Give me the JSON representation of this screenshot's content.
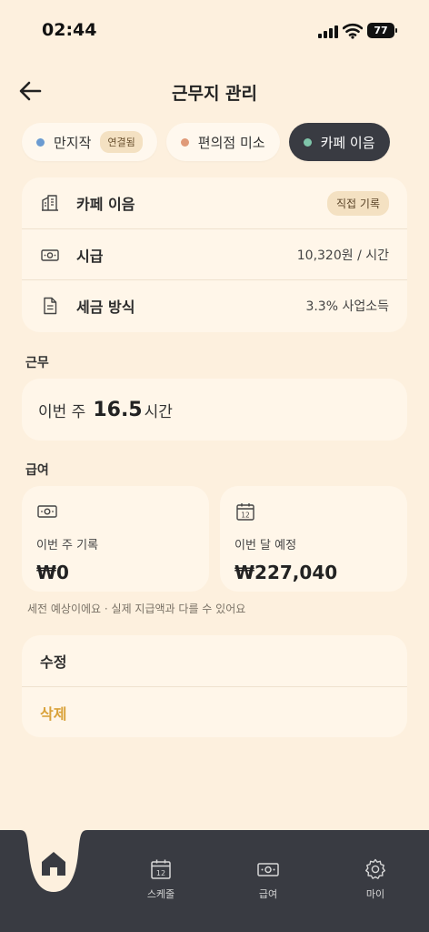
{
  "status_bar": {
    "time": "02:44",
    "battery": "77"
  },
  "header": {
    "title": "근무지 관리"
  },
  "workplaces": [
    {
      "name": "만지작",
      "tag": "연결됨",
      "color": "#6B9BD1",
      "active": false
    },
    {
      "name": "편의점 미소",
      "tag": "",
      "color": "#E09A78",
      "active": false
    },
    {
      "name": "카페 이음",
      "tag": "",
      "color": "#7FC5AA",
      "active": true
    }
  ],
  "details": {
    "name_label": "카페 이음",
    "name_badge": "직접 기록",
    "wage_label": "시급",
    "wage_value": "10,320원 / 시간",
    "tax_label": "세금 방식",
    "tax_value": "3.3% 사업소득"
  },
  "work": {
    "section": "근무",
    "prefix": "이번 주",
    "hours": "16.5",
    "unit": "시간"
  },
  "pay": {
    "section": "급여",
    "week_label": "이번 주 기록",
    "week_value": "₩0",
    "month_label": "이번 달 예정",
    "month_value": "₩227,040",
    "note": "세전 예상이에요 · 실제 지급액과 다를 수 있어요"
  },
  "actions": {
    "edit": "수정",
    "delete": "삭제"
  },
  "tabbar": {
    "schedule": "스케줄",
    "pay": "급여",
    "my": "마이",
    "calendar_day": "12"
  },
  "colors": {
    "background": "#FDF0DE",
    "card": "#FFF6E9",
    "tabbar": "#393B42",
    "accent": "#D9A23A"
  }
}
